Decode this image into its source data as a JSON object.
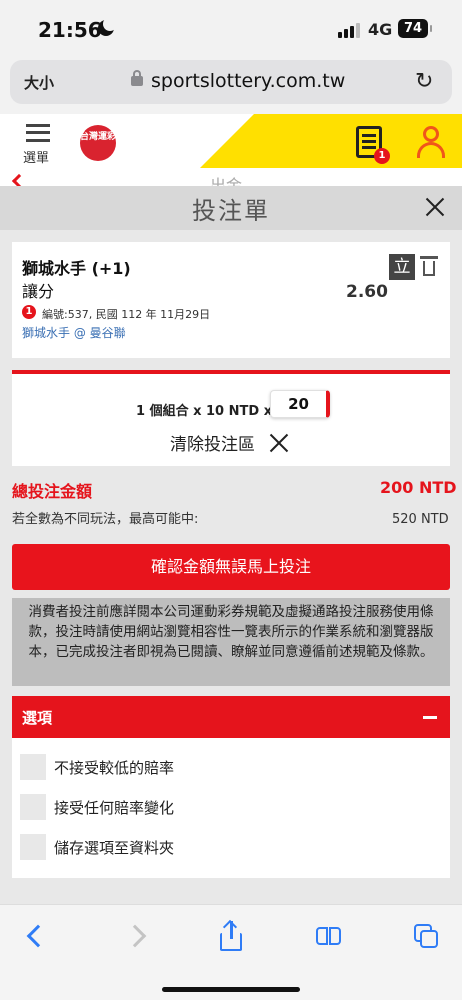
{
  "status_bar": {
    "time": "21:56",
    "network": "4G",
    "battery": "74"
  },
  "browser": {
    "text_size_button": "大小",
    "url": "sportslottery.com.tw"
  },
  "site_header": {
    "menu_label": "選單",
    "logo_text": "台灣運彩",
    "betslip_count": "1",
    "accent_color": "#ffe000"
  },
  "page_peek_text": "出金",
  "betslip": {
    "title": "投注單",
    "bet": {
      "team": "獅城水手 (+1)",
      "market": "讓分",
      "odds": "2.60",
      "stand_label": "立",
      "index": "1",
      "meta": "編號:537, 民國 112 年 11月29日",
      "match": "獅城水手 @ 曼谷聯"
    },
    "stake": {
      "combo_text": "1 個組合 x 10 NTD x",
      "multiplier": "20",
      "clear_label": "清除投注區"
    },
    "total_label": "總投注金額",
    "total_value": "200 NTD",
    "potential_label": "若全數為不同玩法，最高可能中:",
    "potential_value": "520 NTD",
    "confirm_button": "確認金額無誤馬上投注",
    "notice": "消費者投注前應詳閱本公司運動彩券規範及虛擬通路投注服務使用條款，投注時請使用網站瀏覽相容性一覽表所示的作業系統和瀏覽器版本，已完成投注者即視為已閱讀、瞭解並同意遵循前述規範及條款。",
    "options": {
      "title": "選項",
      "items": [
        {
          "label": "不接受較低的賠率"
        },
        {
          "label": "接受任何賠率變化"
        },
        {
          "label": "儲存選項至資料夾"
        }
      ]
    },
    "brand_red": "#e5141c"
  }
}
